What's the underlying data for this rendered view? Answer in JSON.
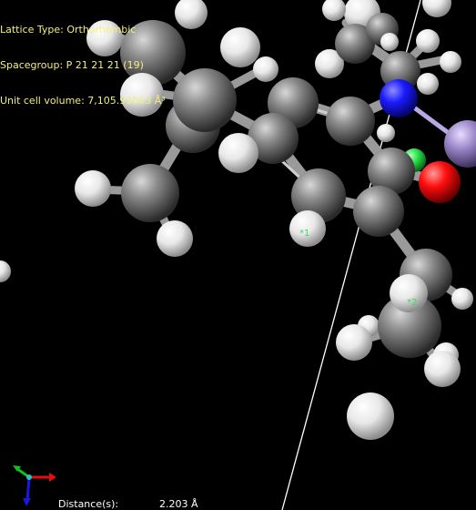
{
  "info": {
    "lattice_type": "Lattice Type: Orthorhombic",
    "spacegroup": "Spacegroup: P 21 21 21 (19)",
    "cell_volume": "Unit cell volume: 7,105.93063 Å³"
  },
  "measurement": {
    "label": "Distance(s):",
    "value": "2.203 Å"
  },
  "atom_labels": {
    "first": "*1",
    "second": "*2"
  },
  "colors": {
    "background": "#000000",
    "info_text": "#f2ef7a",
    "carbon": "#8a8a8a",
    "hydrogen": "#f4f4f4",
    "nitrogen": "#1a1aff",
    "oxygen": "#ff0d0d",
    "fluorine_green": "#29e34a",
    "heavy_atom": "#9a86c8",
    "cell_edge": "#ffffff"
  }
}
